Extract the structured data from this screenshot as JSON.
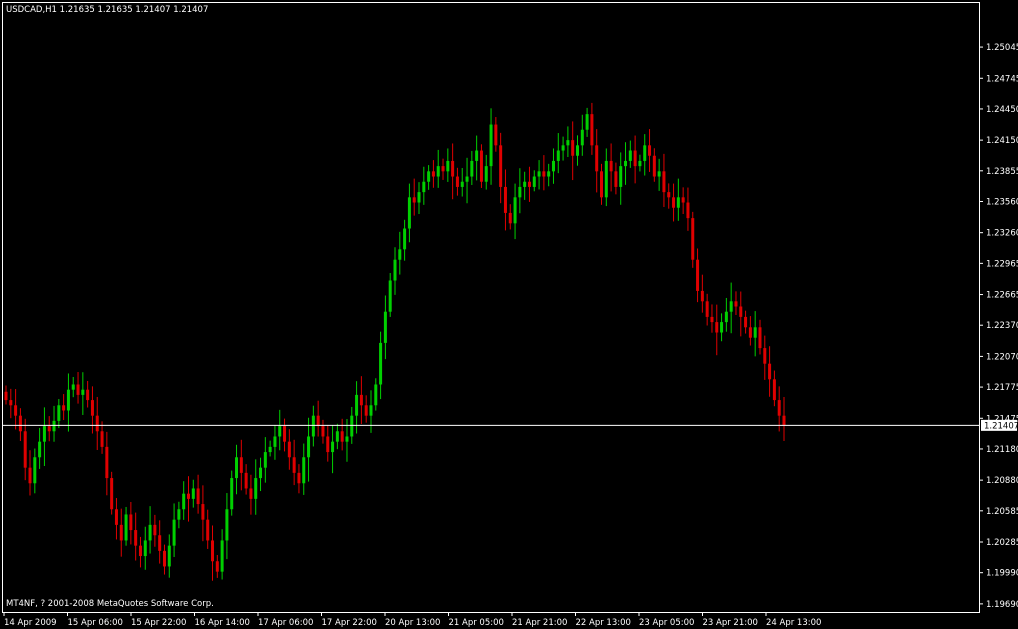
{
  "header": {
    "symbol_info": "USDCAD,H1  1.21635 1.21635 1.21407 1.21407"
  },
  "footer": {
    "copyright": "MT4NF, ? 2001-2008 MetaQuotes Software Corp."
  },
  "colors": {
    "background": "#000000",
    "frame": "#ffffff",
    "bull": "#00d000",
    "bear": "#e00000",
    "price_line": "#ffffff"
  },
  "chart_data": {
    "type": "candlestick",
    "symbol": "USDCAD",
    "timeframe": "H1",
    "ohlc_header": {
      "open": 1.21635,
      "high": 1.21635,
      "low": 1.21407,
      "close": 1.21407
    },
    "current_price": 1.21407,
    "current_price_label": "1.21407",
    "ylim": [
      1.1966,
      1.2519
    ],
    "y_ticks": [
      "1.25045",
      "1.24745",
      "1.24450",
      "1.24150",
      "1.23855",
      "1.23560",
      "1.23260",
      "1.22965",
      "1.22665",
      "1.22370",
      "1.22070",
      "1.21775",
      "1.21475",
      "1.21180",
      "1.20880",
      "1.20585",
      "1.20285",
      "1.19990",
      "1.19690"
    ],
    "x_ticks": [
      "14 Apr 2009",
      "15 Apr 06:00",
      "15 Apr 22:00",
      "16 Apr 14:00",
      "17 Apr 06:00",
      "17 Apr 22:00",
      "20 Apr 13:00",
      "21 Apr 05:00",
      "21 Apr 21:00",
      "22 Apr 13:00",
      "23 Apr 05:00",
      "23 Apr 21:00",
      "24 Apr 13:00"
    ],
    "grid": false,
    "closes": [
      1.2165,
      1.216,
      1.215,
      1.2135,
      1.21,
      1.2085,
      1.211,
      1.2125,
      1.214,
      1.2135,
      1.2145,
      1.216,
      1.2155,
      1.2175,
      1.218,
      1.217,
      1.2175,
      1.2165,
      1.215,
      1.2135,
      1.212,
      1.209,
      1.206,
      1.2045,
      1.203,
      1.2055,
      1.204,
      1.2025,
      1.2015,
      1.203,
      1.2045,
      1.2035,
      1.202,
      1.2005,
      1.2025,
      1.205,
      1.206,
      1.2075,
      1.207,
      1.208,
      1.2065,
      1.205,
      1.203,
      1.201,
      1.2,
      1.203,
      1.206,
      1.209,
      1.211,
      1.2095,
      1.208,
      1.207,
      1.209,
      1.21,
      1.2115,
      1.212,
      1.213,
      1.214,
      1.2125,
      1.211,
      1.2095,
      1.2085,
      1.211,
      1.213,
      1.215,
      1.214,
      1.213,
      1.2115,
      1.2125,
      1.2135,
      1.2125,
      1.213,
      1.215,
      1.217,
      1.216,
      1.215,
      1.216,
      1.218,
      1.222,
      1.225,
      1.228,
      1.23,
      1.231,
      1.233,
      1.236,
      1.2355,
      1.2365,
      1.2375,
      1.2385,
      1.238,
      1.239,
      1.2385,
      1.2395,
      1.238,
      1.237,
      1.2375,
      1.238,
      1.2395,
      1.2405,
      1.2375,
      1.239,
      1.243,
      1.241,
      1.237,
      1.2345,
      1.2335,
      1.236,
      1.237,
      1.2375,
      1.237,
      1.238,
      1.2385,
      1.238,
      1.2385,
      1.2395,
      1.2405,
      1.241,
      1.2415,
      1.24,
      1.241,
      1.2425,
      1.244,
      1.241,
      1.2385,
      1.236,
      1.2395,
      1.2385,
      1.237,
      1.239,
      1.2395,
      1.2405,
      1.239,
      1.2395,
      1.241,
      1.24,
      1.238,
      1.2385,
      1.2365,
      1.236,
      1.235,
      1.236,
      1.2355,
      1.234,
      1.23,
      1.227,
      1.226,
      1.2245,
      1.224,
      1.223,
      1.224,
      1.225,
      1.226,
      1.2255,
      1.2245,
      1.2235,
      1.2225,
      1.2235,
      1.2215,
      1.22,
      1.2185,
      1.2165,
      1.215,
      1.2141
    ]
  }
}
